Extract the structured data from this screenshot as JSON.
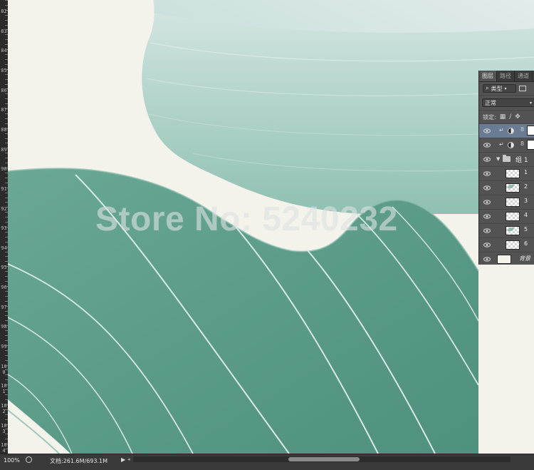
{
  "ruler": {
    "labels": [
      "82",
      "83",
      "84",
      "85",
      "86",
      "87",
      "88",
      "89",
      "90",
      "91",
      "92",
      "93",
      "94",
      "95",
      "96",
      "97",
      "98",
      "99",
      "100",
      "101",
      "102",
      "103",
      "104"
    ]
  },
  "canvas": {
    "watermark": "Store No: 5240232",
    "colors": {
      "background": "#f3f3ec",
      "sea_green": "#5a9b87",
      "pale_green": "#b9d8d0",
      "vein": "#d6ebe4"
    }
  },
  "layers_panel": {
    "tabs": [
      {
        "label": "图层",
        "active": true
      },
      {
        "label": "路径",
        "active": false
      },
      {
        "label": "通道",
        "active": false
      }
    ],
    "filter": {
      "label": "类型"
    },
    "blend_mode": "正常",
    "lock_label": "锁定:",
    "group": {
      "name": "组 1"
    },
    "layers": [
      {
        "name": "1",
        "thumb": "transparent"
      },
      {
        "name": "2",
        "thumb": "leaf"
      },
      {
        "name": "3",
        "thumb": "transparent"
      },
      {
        "name": "4",
        "thumb": "transparent"
      },
      {
        "name": "5",
        "thumb": "leaf"
      },
      {
        "name": "6",
        "thumb": "transparent"
      }
    ],
    "background_layer": {
      "name": "背景"
    }
  },
  "status_bar": {
    "zoom": "100%",
    "doc_size": "文档:261.6M/693.1M"
  }
}
